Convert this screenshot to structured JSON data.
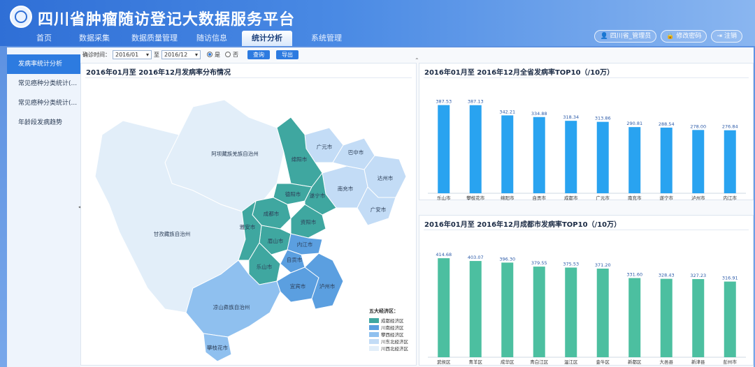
{
  "header": {
    "title": "四川省肿瘤随访登记大数据服务平台"
  },
  "nav": {
    "items": [
      {
        "label": "首页",
        "active": false
      },
      {
        "label": "数据采集",
        "active": false
      },
      {
        "label": "数据质量管理",
        "active": false
      },
      {
        "label": "随访信息",
        "active": false
      },
      {
        "label": "统计分析",
        "active": true
      },
      {
        "label": "系统管理",
        "active": false
      }
    ]
  },
  "user": {
    "name": "四川省_管理员",
    "change_pwd": "修改密码",
    "logout": "注销"
  },
  "sidebar": {
    "items": [
      {
        "label": "发病率统计分析",
        "active": true
      },
      {
        "label": "常见癌种分类统计(...",
        "active": false
      },
      {
        "label": "常见癌种分类统计(...",
        "active": false
      },
      {
        "label": "年龄段发病趋势",
        "active": false
      }
    ]
  },
  "toolbar": {
    "time_label": "确诊时间：",
    "start": "2016/01",
    "to": "至",
    "end": "2016/12",
    "opt1": "是",
    "opt2": "否",
    "query": "查询",
    "export": "导出"
  },
  "map_panel": {
    "title": "2016年01月至 2016年12月发病率分布情况"
  },
  "top_panel": {
    "title": "2016年01月至 2016年12月全省发病率TOP10（/10万）"
  },
  "bot_panel": {
    "title": "2016年01月至 2016年12月成都市发病率TOP10（/10万）"
  },
  "legend": {
    "title": "五大经济区：",
    "items": [
      {
        "label": "成都经济区",
        "color": "#3fa7a0"
      },
      {
        "label": "川南经济区",
        "color": "#5b9fe0"
      },
      {
        "label": "攀西经济区",
        "color": "#8fc0ef"
      },
      {
        "label": "川东北经济区",
        "color": "#c3dcf6"
      },
      {
        "label": "川西北经济区",
        "color": "#e2eef9"
      }
    ]
  },
  "map_regions": [
    {
      "name": "阿坝藏族羌族自治州",
      "zone": 4
    },
    {
      "name": "甘孜藏族自治州",
      "zone": 4
    },
    {
      "name": "广元市",
      "zone": 3
    },
    {
      "name": "巴中市",
      "zone": 3
    },
    {
      "name": "达州市",
      "zone": 3
    },
    {
      "name": "南充市",
      "zone": 3
    },
    {
      "name": "广安市",
      "zone": 3
    },
    {
      "name": "绵阳市",
      "zone": 0
    },
    {
      "name": "德阳市",
      "zone": 0
    },
    {
      "name": "遂宁市",
      "zone": 0
    },
    {
      "name": "成都市",
      "zone": 0
    },
    {
      "name": "资阳市",
      "zone": 0
    },
    {
      "name": "眉山市",
      "zone": 0
    },
    {
      "name": "雅安市",
      "zone": 0
    },
    {
      "name": "内江市",
      "zone": 1
    },
    {
      "name": "自贡市",
      "zone": 1
    },
    {
      "name": "乐山市",
      "zone": 0
    },
    {
      "name": "宜宾市",
      "zone": 1
    },
    {
      "name": "泸州市",
      "zone": 1
    },
    {
      "name": "凉山彝族自治州",
      "zone": 2
    },
    {
      "name": "攀枝花市",
      "zone": 2
    }
  ],
  "colors": {
    "bar_blue": "#29a3f0",
    "bar_green": "#4cbfa0",
    "accent": "#2d7be0"
  },
  "chart_data": [
    {
      "type": "bar",
      "title": "2016年01月至 2016年12月全省发病率TOP10（/10万）",
      "categories": [
        "乐山市",
        "攀枝花市",
        "绵阳市",
        "自贡市",
        "成都市",
        "广元市",
        "南充市",
        "遂宁市",
        "泸州市",
        "内江市"
      ],
      "values": [
        387.53,
        387.13,
        342.21,
        334.88,
        318.34,
        313.86,
        290.81,
        288.54,
        278.0,
        276.84
      ],
      "ylim": [
        0,
        420
      ],
      "grid": false
    },
    {
      "type": "bar",
      "title": "2016年01月至 2016年12月成都市发病率TOP10（/10万）",
      "categories": [
        "武侯区",
        "青羊区",
        "成华区",
        "青白江区",
        "温江区",
        "金牛区",
        "新都区",
        "大邑县",
        "新津县",
        "彭州市"
      ],
      "values": [
        414.68,
        403.07,
        396.3,
        379.55,
        375.53,
        371.2,
        331.6,
        328.43,
        327.23,
        316.91
      ],
      "ylim": [
        0,
        450
      ],
      "grid": false
    }
  ]
}
